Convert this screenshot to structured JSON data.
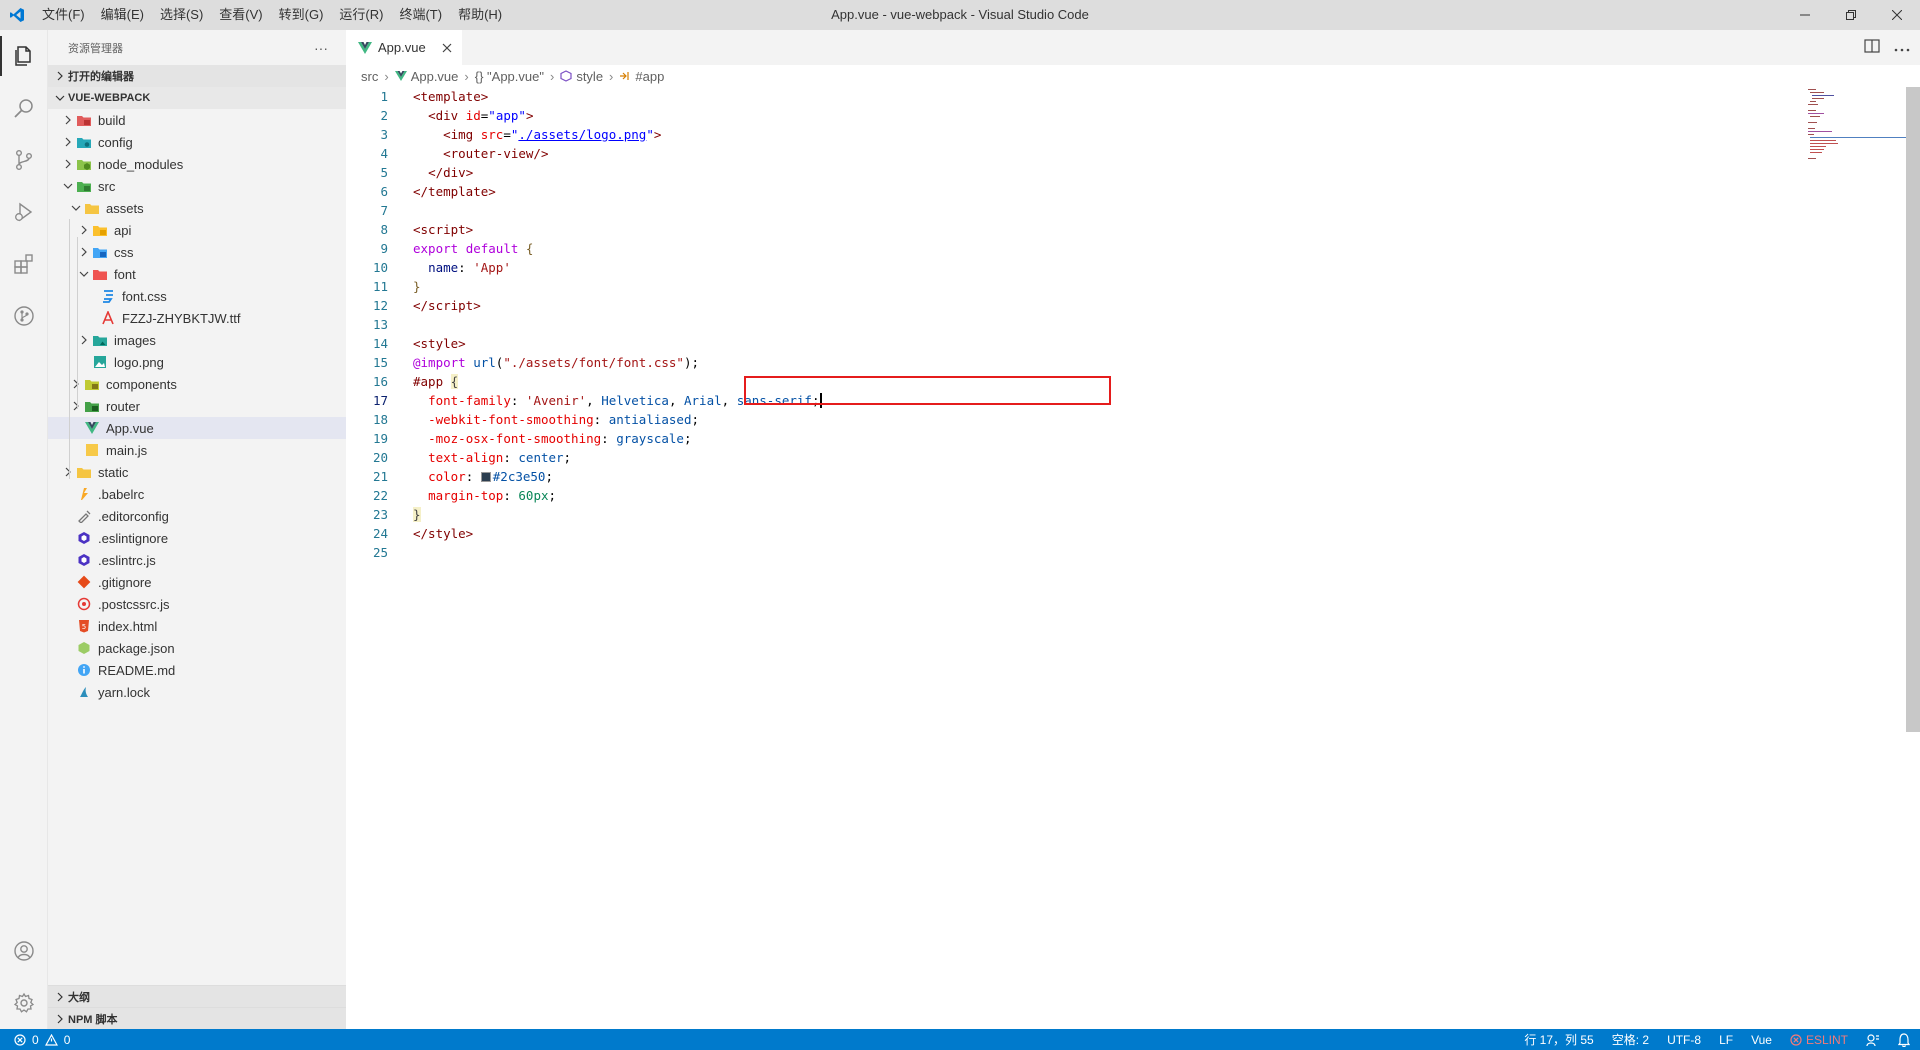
{
  "window": {
    "title": "App.vue - vue-webpack - Visual Studio Code",
    "menu": [
      "文件(F)",
      "编辑(E)",
      "选择(S)",
      "查看(V)",
      "转到(G)",
      "运行(R)",
      "终端(T)",
      "帮助(H)"
    ]
  },
  "colors": {
    "accent": "#007acc",
    "highlight_box": "#e51c1c",
    "color_swatch": "#2c3e50"
  },
  "sidebar": {
    "title": "资源管理器",
    "more": "···",
    "open_editors": "打开的编辑器",
    "project": "VUE-WEBPACK",
    "tree": [
      {
        "label": "build",
        "icon": "folder-red"
      },
      {
        "label": "config",
        "icon": "folder-config"
      },
      {
        "label": "node_modules",
        "icon": "folder-node"
      },
      {
        "label": "src",
        "icon": "folder-src"
      },
      {
        "label": "assets",
        "icon": "folder-assets"
      },
      {
        "label": "api",
        "icon": "folder-yellow"
      },
      {
        "label": "css",
        "icon": "folder-css"
      },
      {
        "label": "font",
        "icon": "folder-font"
      },
      {
        "label": "font.css",
        "icon": "css-file"
      },
      {
        "label": "FZZJ-ZHYBKTJW.ttf",
        "icon": "font-file"
      },
      {
        "label": "images",
        "icon": "folder-images"
      },
      {
        "label": "logo.png",
        "icon": "image-file"
      },
      {
        "label": "components",
        "icon": "folder-components"
      },
      {
        "label": "router",
        "icon": "folder-router"
      },
      {
        "label": "App.vue",
        "icon": "vue-file"
      },
      {
        "label": "main.js",
        "icon": "js-file"
      },
      {
        "label": "static",
        "icon": "folder-static"
      },
      {
        "label": ".babelrc",
        "icon": "babel-file"
      },
      {
        "label": ".editorconfig",
        "icon": "editorconfig-file"
      },
      {
        "label": ".eslintignore",
        "icon": "eslint-file"
      },
      {
        "label": ".eslintrc.js",
        "icon": "eslint-file"
      },
      {
        "label": ".gitignore",
        "icon": "git-file"
      },
      {
        "label": ".postcssrc.js",
        "icon": "postcss-file"
      },
      {
        "label": "index.html",
        "icon": "html-file"
      },
      {
        "label": "package.json",
        "icon": "npm-file"
      },
      {
        "label": "README.md",
        "icon": "info-file"
      },
      {
        "label": "yarn.lock",
        "icon": "yarn-file"
      }
    ],
    "outline": "大纲",
    "npm_scripts": "NPM 脚本"
  },
  "editor": {
    "tab_label": "App.vue",
    "breadcrumb": [
      "src",
      "App.vue",
      "{} \"App.vue\"",
      "style",
      "#app"
    ],
    "line_numbers": [
      "1",
      "2",
      "3",
      "4",
      "5",
      "6",
      "7",
      "8",
      "9",
      "10",
      "11",
      "12",
      "13",
      "14",
      "15",
      "16",
      "17",
      "18",
      "19",
      "20",
      "21",
      "22",
      "23",
      "24",
      "25"
    ]
  },
  "status": {
    "errors": "0",
    "warnings": "0",
    "position": "行 17，列 55",
    "spaces": "空格: 2",
    "encoding": "UTF-8",
    "eol": "LF",
    "language": "Vue",
    "eslint": "ESLINT"
  }
}
